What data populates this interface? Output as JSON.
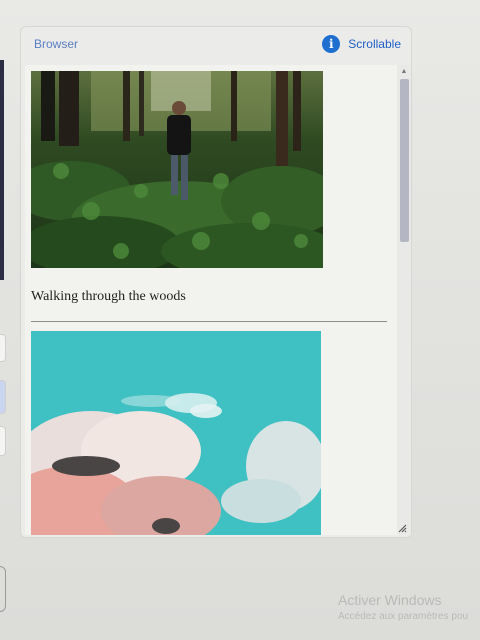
{
  "panel": {
    "title": "Browser",
    "scroll_indicator": {
      "icon": "info-icon",
      "label": "Scrollable"
    }
  },
  "feed": {
    "items": [
      {
        "type": "image",
        "subject": "forest-hiker-photo",
        "caption": "Walking through the woods"
      },
      {
        "type": "image",
        "subject": "cloudy-sky-photo"
      }
    ]
  },
  "scrollbar": {
    "position_fraction": 0.0,
    "thumb_fraction": 0.36
  },
  "watermark": {
    "line1": "Activer Windows",
    "line2": "Accédez aux paramètres pou"
  },
  "colors": {
    "title": "#5b7fc2",
    "accent": "#1f6fd1",
    "sky": "#3bc2c4"
  }
}
